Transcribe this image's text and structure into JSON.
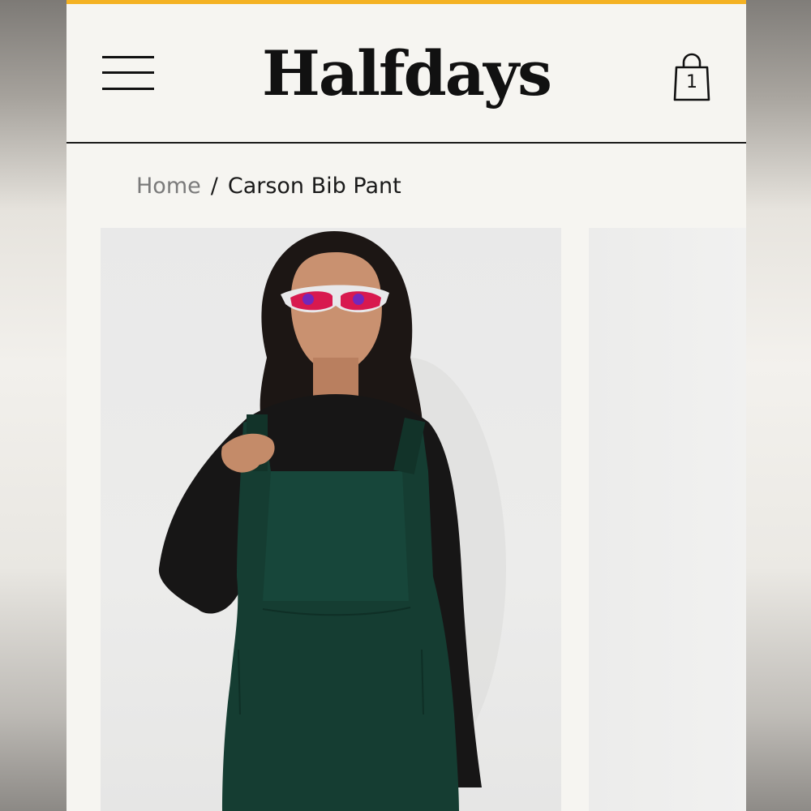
{
  "brand": {
    "name": "Halfdays",
    "accent_color": "#f4b223"
  },
  "header": {
    "menu_icon": "hamburger-menu-icon",
    "cart_icon": "shopping-bag-icon",
    "cart_count": "1"
  },
  "breadcrumb": {
    "home": "Home",
    "separator": "/",
    "current": "Carson Bib Pant"
  },
  "product": {
    "image_description_icon": "product-photo"
  }
}
